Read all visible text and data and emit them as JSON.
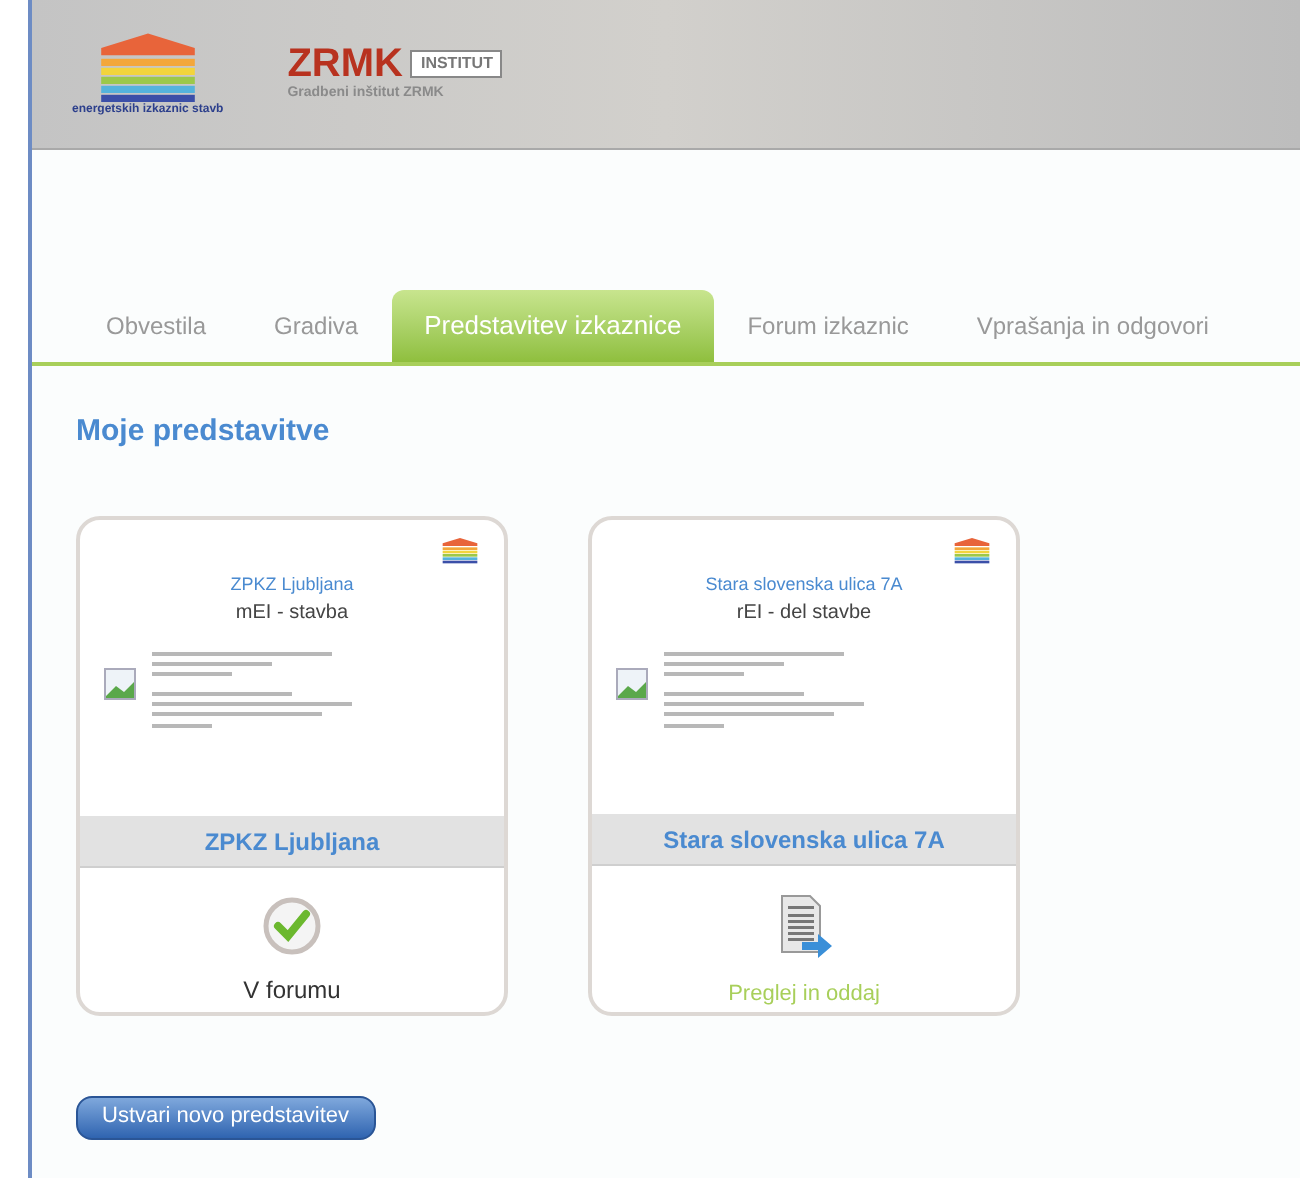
{
  "header": {
    "logo_caption": "energetskih izkaznic stavb",
    "brand_mark": "ZRMK",
    "brand_badge": "INSTITUT",
    "brand_name": "Gradbeni inštitut ZRMK"
  },
  "tabs": [
    {
      "label": "Obvestila",
      "selected": false
    },
    {
      "label": "Gradiva",
      "selected": false
    },
    {
      "label": "Predstavitev izkaznice",
      "selected": true
    },
    {
      "label": "Forum izkaznic",
      "selected": false
    },
    {
      "label": "Vprašanja in odgovori",
      "selected": false
    }
  ],
  "section_title": "Moje predstavitve",
  "cards": [
    {
      "title": "ZPKZ Ljubljana",
      "subtitle": "mEI - stavba",
      "name": "ZPKZ Ljubljana",
      "kind": "forum",
      "status": "V forumu"
    },
    {
      "title": "Stara slovenska ulica 7A",
      "subtitle": "rEI - del stavbe",
      "name": "Stara slovenska ulica 7A",
      "kind": "publish",
      "status": "Preglej in oddaj"
    }
  ],
  "create_button": "Ustvari novo predstavitev"
}
